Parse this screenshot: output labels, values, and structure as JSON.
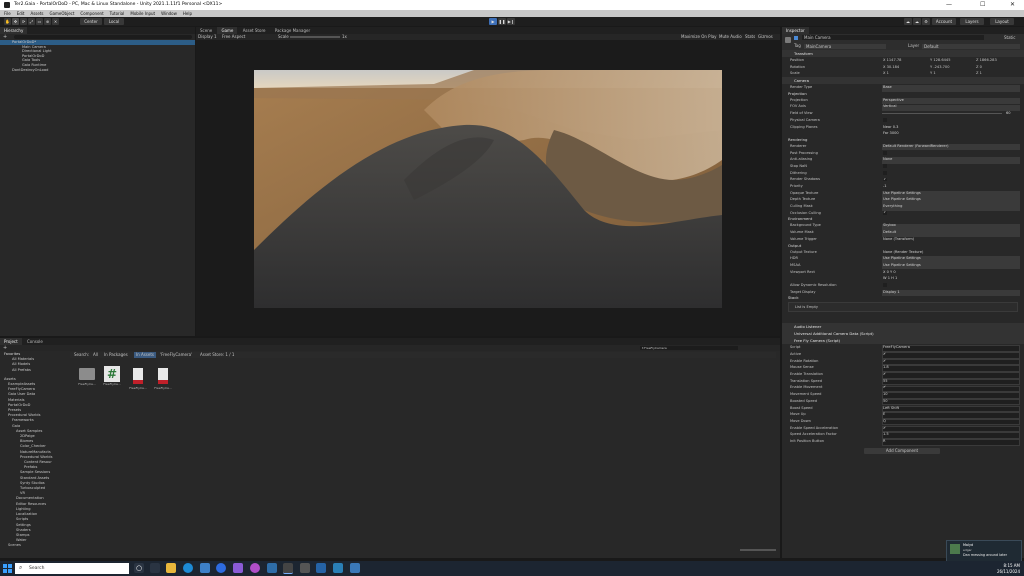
{
  "window": {
    "title": "Ter2.Gaia - PortalOrDoD - PC, Mac & Linux Standalone - Unity 2021.1.11f1 Personal <DX11>",
    "minimize": "—",
    "maximize": "☐",
    "close": "✕"
  },
  "menu": [
    "File",
    "Edit",
    "Assets",
    "GameObject",
    "Component",
    "Tutorial",
    "Mobile Input",
    "Window",
    "Help"
  ],
  "toolbar": {
    "center_label": "Center",
    "local_label": "Local",
    "account_label": "Account",
    "layers_label": "Layers",
    "layout_label": "Layout",
    "play": "▶",
    "pause": "❚❚",
    "step": "▶❙"
  },
  "hierarchy": {
    "tab": "Hierarchy",
    "add": "+",
    "items": [
      "PortalOrDoD*",
      "Main Camera",
      "Directional Light",
      "PortalOrDoD",
      "Gaia Tools",
      "Gaia Runtime",
      "DontDestroyOnLoad"
    ]
  },
  "game_view": {
    "tabs": [
      "Scene",
      "Game",
      "Asset Store",
      "Package Manager"
    ],
    "display": "Display 1",
    "aspect": "Free Aspect",
    "scale_label": "Scale",
    "scale_value": "1x",
    "options": [
      "Maximize On Play",
      "Mute Audio",
      "Stats",
      "Gizmos"
    ]
  },
  "inspector": {
    "tab": "Inspector",
    "object_name": "Main Camera",
    "static": "Static",
    "tag_label": "Tag",
    "tag_value": "MainCamera",
    "layer_label": "Layer",
    "layer_value": "Default",
    "transform": {
      "title": "Transform",
      "position_label": "Position",
      "position": [
        "X 1147.78",
        "Y 128.6445",
        "Z 1866.283"
      ],
      "rotation_label": "Rotation",
      "rotation": [
        "X 30.184",
        "Y -243.700",
        "Z 0"
      ],
      "scale_label": "Scale",
      "scale": [
        "X 1",
        "Y 1",
        "Z 1"
      ]
    },
    "camera": {
      "title": "Camera",
      "rows": [
        {
          "label": "Render Type",
          "value": "Base",
          "kind": "dropdown"
        },
        {
          "label": "Projection",
          "value": "",
          "kind": "header"
        },
        {
          "label": "Projection",
          "value": "Perspective",
          "kind": "dropdown"
        },
        {
          "label": "FOV Axis",
          "value": "Vertical",
          "kind": "dropdown"
        },
        {
          "label": "Field of View",
          "value": "60",
          "kind": "slider"
        },
        {
          "label": "Physical Camera",
          "value": "",
          "kind": "check"
        },
        {
          "label": "Clipping Planes",
          "value": "Near  0.3",
          "kind": "text"
        },
        {
          "label": "",
          "value": "Far   3000",
          "kind": "text"
        },
        {
          "label": "Rendering",
          "value": "",
          "kind": "header"
        },
        {
          "label": "Renderer",
          "value": "Default Renderer (ForwardRenderer)",
          "kind": "dropdown"
        },
        {
          "label": "Post Processing",
          "value": "",
          "kind": "check"
        },
        {
          "label": "Anti-aliasing",
          "value": "None",
          "kind": "dropdown"
        },
        {
          "label": "Stop NaN",
          "value": "",
          "kind": "check"
        },
        {
          "label": "Dithering",
          "value": "",
          "kind": "check"
        },
        {
          "label": "Render Shadows",
          "value": "✔",
          "kind": "check"
        },
        {
          "label": "Priority",
          "value": "-1",
          "kind": "text"
        },
        {
          "label": "Opaque Texture",
          "value": "Use Pipeline Settings",
          "kind": "dropdown"
        },
        {
          "label": "Depth Texture",
          "value": "Use Pipeline Settings",
          "kind": "dropdown"
        },
        {
          "label": "Culling Mask",
          "value": "Everything",
          "kind": "dropdown"
        },
        {
          "label": "Occlusion Culling",
          "value": "✔",
          "kind": "check"
        },
        {
          "label": "Environment",
          "value": "",
          "kind": "header"
        },
        {
          "label": "Background Type",
          "value": "Skybox",
          "kind": "dropdown"
        },
        {
          "label": "Volume Mask",
          "value": "Default",
          "kind": "dropdown"
        },
        {
          "label": "Volume Trigger",
          "value": "None (Transform)",
          "kind": "text"
        },
        {
          "label": "Output",
          "value": "",
          "kind": "header"
        },
        {
          "label": "Output Texture",
          "value": "None (Render Texture)",
          "kind": "text"
        },
        {
          "label": "HDR",
          "value": "Use Pipeline Settings",
          "kind": "dropdown"
        },
        {
          "label": "MSAA",
          "value": "Use Pipeline Settings",
          "kind": "dropdown"
        },
        {
          "label": "Viewport Rect",
          "value": "X 0        Y 0",
          "kind": "text"
        },
        {
          "label": "",
          "value": "W 1        H 1",
          "kind": "text"
        },
        {
          "label": "Allow Dynamic Resolution",
          "value": "",
          "kind": "check"
        },
        {
          "label": "Target Display",
          "value": "Display 1",
          "kind": "dropdown"
        },
        {
          "label": "Stack",
          "value": "",
          "kind": "header"
        }
      ],
      "stack_empty": "List is Empty"
    },
    "components": [
      "Audio Listener",
      "Universal Additional Camera Data (Script)",
      "Free Fly Camera (Script)"
    ],
    "freefly": {
      "rows": [
        {
          "label": "Script",
          "value": "FreeFlyCamera"
        },
        {
          "label": "Active",
          "value": "✔"
        },
        {
          "label": "Enable Rotation",
          "value": "✔"
        },
        {
          "label": "Mouse Sense",
          "value": "1.8"
        },
        {
          "label": "Enable Translation",
          "value": "✔"
        },
        {
          "label": "Translation Speed",
          "value": "55"
        },
        {
          "label": "Enable Movement",
          "value": "✔"
        },
        {
          "label": "Movement Speed",
          "value": "10"
        },
        {
          "label": "Boosted Speed",
          "value": "50"
        },
        {
          "label": "Boost Speed",
          "value": "Left Shift"
        },
        {
          "label": "Move Up",
          "value": "E"
        },
        {
          "label": "Move Down",
          "value": "Q"
        },
        {
          "label": "Enable Speed Acceleration",
          "value": "✔"
        },
        {
          "label": "Speed Acceleration Factor",
          "value": "1.5"
        },
        {
          "label": "Init Position Button",
          "value": "R"
        }
      ]
    },
    "add_component": "Add Component"
  },
  "project": {
    "tabs": [
      "Project",
      "Console"
    ],
    "favorites_label": "Favorites",
    "favorites": [
      "All Materials",
      "All Models",
      "All Prefabs"
    ],
    "tree": [
      "Assets",
      "ExampleAssets",
      "FreeFlyCamera",
      "Gaia User Data",
      "Materials",
      "PortalOrDoD",
      "Presets",
      "Procedural Worlds",
      "Frameworks",
      "Gaia",
      "Asset Samples",
      "2DPaige",
      "Biomes",
      "Color_Checker",
      "NatureManufacts",
      "Procedural Worlds",
      "Content Resour",
      "Prefabs",
      "Sample Sessions",
      "Standard Assets",
      "Synty Studios",
      "Turbosculpted",
      "VR",
      "Documentation",
      "Editor Resources",
      "Lighting",
      "Localization",
      "Scripts",
      "Settings",
      "Shaders",
      "Stamps",
      "Water",
      "Scenes"
    ],
    "search_filters": [
      "Search:",
      "All",
      "In Packages",
      "In Assets",
      "'FreeFlyCamera'",
      "Asset Store: 1 / 1"
    ],
    "assets": [
      "FreeFlyCa...",
      "FreeFlyCa...",
      "FreeFlyCa...",
      "FreeFlyCa..."
    ]
  },
  "notification": {
    "title": "Malyd",
    "subtitle": "edgar",
    "text": "Dan messing around later"
  },
  "taskbar": {
    "search": "Search",
    "time": "8:15 AM",
    "date": "26/11/2024"
  }
}
